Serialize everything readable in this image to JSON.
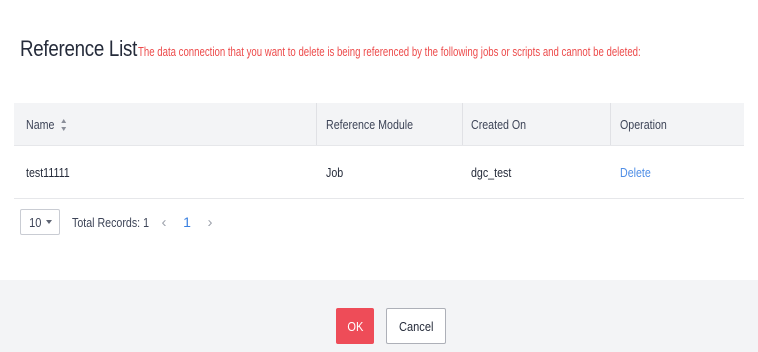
{
  "dialog": {
    "title": "Reference List",
    "warning": "The data connection that you want to delete is being referenced by the following jobs or scripts and cannot be deleted:"
  },
  "table": {
    "columns": [
      "Name",
      "Reference Module",
      "Created On",
      "Operation"
    ],
    "rows": [
      {
        "name": "test11111",
        "module": "Job",
        "created_on": "dgc_test",
        "operation": "Delete"
      }
    ]
  },
  "pagination": {
    "page_size": "10",
    "total_records": "Total Records: 1",
    "current_page": "1"
  },
  "footer": {
    "ok_label": "OK",
    "cancel_label": "Cancel"
  },
  "colors": {
    "warning": "#ed4b4b",
    "link": "#4f8ee6",
    "primary_button": "#ee4c58",
    "header_bg": "#f3f4f6"
  }
}
